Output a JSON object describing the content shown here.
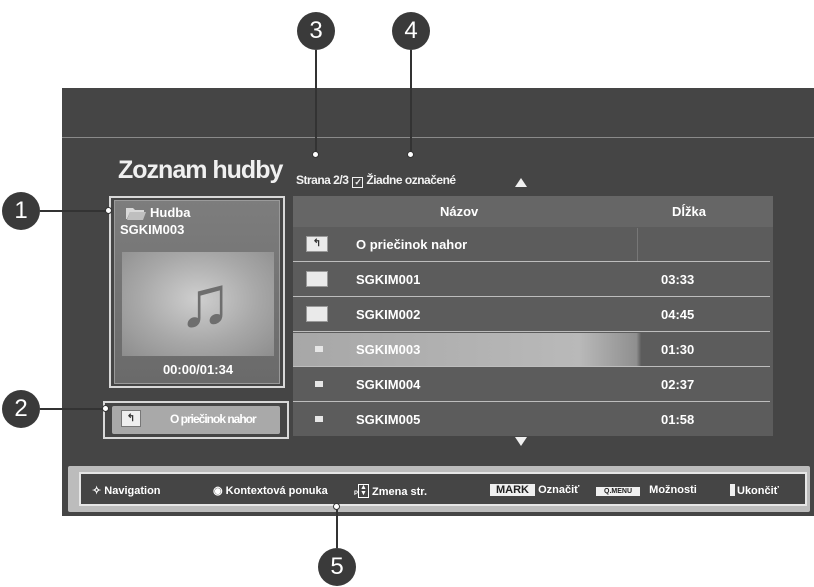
{
  "title": "Zoznam hudby",
  "page_info": "Strana 2/3",
  "marked_status": "Žiadne označené",
  "left_panel": {
    "folder_label": "Hudba",
    "item_name": "SGKIM003",
    "time": "00:00/01:34"
  },
  "up_button_label": "O priečinok nahor",
  "table": {
    "col_name": "Názov",
    "col_length": "Dĺžka",
    "rows": [
      {
        "name": "O priečinok nahor",
        "length": ""
      },
      {
        "name": "SGKIM001",
        "length": "03:33"
      },
      {
        "name": "SGKIM002",
        "length": "04:45"
      },
      {
        "name": "SGKIM003",
        "length": "01:30"
      },
      {
        "name": "SGKIM004",
        "length": "02:37"
      },
      {
        "name": "SGKIM005",
        "length": "01:58"
      }
    ]
  },
  "bottom_bar": {
    "navigation": "Navigation",
    "context_menu": "Kontextová ponuka",
    "page_change_prefix": "P",
    "page_change": "Zmena str.",
    "mark_key": "MARK",
    "mark_label": "Označiť",
    "qmenu_key": "Q.MENU",
    "options_label": "Možnosti",
    "exit_label": "Ukončiť"
  },
  "callouts": [
    "1",
    "2",
    "3",
    "4",
    "5"
  ]
}
